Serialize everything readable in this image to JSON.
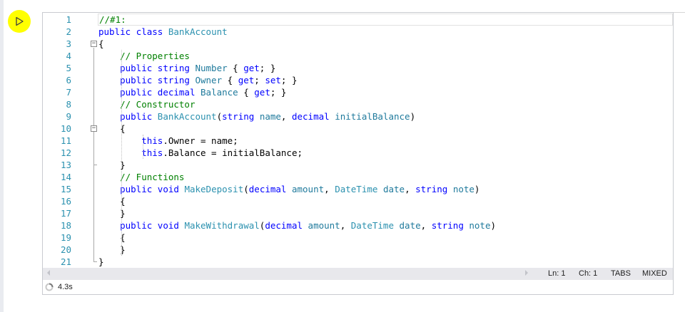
{
  "toolbar": {
    "run_icon": "run-triangle-icon",
    "highlight_color": "#ffff00"
  },
  "editor": {
    "lines": [
      {
        "n": "1",
        "tokens": [
          [
            "cmt",
            "//#1:"
          ]
        ]
      },
      {
        "n": "2",
        "tokens": [
          [
            "kw",
            "public"
          ],
          [
            "txt",
            " "
          ],
          [
            "kw",
            "class"
          ],
          [
            "txt",
            " "
          ],
          [
            "type",
            "BankAccount"
          ]
        ]
      },
      {
        "n": "3",
        "tokens": [
          [
            "txt",
            "{"
          ]
        ]
      },
      {
        "n": "4",
        "tokens": [
          [
            "txt",
            "    "
          ],
          [
            "cmt",
            "// Properties"
          ]
        ]
      },
      {
        "n": "5",
        "tokens": [
          [
            "txt",
            "    "
          ],
          [
            "kw",
            "public"
          ],
          [
            "txt",
            " "
          ],
          [
            "kw",
            "string"
          ],
          [
            "txt",
            " "
          ],
          [
            "param",
            "Number"
          ],
          [
            "txt",
            " { "
          ],
          [
            "kw",
            "get"
          ],
          [
            "txt",
            "; }"
          ]
        ]
      },
      {
        "n": "6",
        "tokens": [
          [
            "txt",
            "    "
          ],
          [
            "kw",
            "public"
          ],
          [
            "txt",
            " "
          ],
          [
            "kw",
            "string"
          ],
          [
            "txt",
            " "
          ],
          [
            "param",
            "Owner"
          ],
          [
            "txt",
            " { "
          ],
          [
            "kw",
            "get"
          ],
          [
            "txt",
            "; "
          ],
          [
            "kw",
            "set"
          ],
          [
            "txt",
            "; }"
          ]
        ]
      },
      {
        "n": "7",
        "tokens": [
          [
            "txt",
            "    "
          ],
          [
            "kw",
            "public"
          ],
          [
            "txt",
            " "
          ],
          [
            "kw",
            "decimal"
          ],
          [
            "txt",
            " "
          ],
          [
            "param",
            "Balance"
          ],
          [
            "txt",
            " { "
          ],
          [
            "kw",
            "get"
          ],
          [
            "txt",
            "; }"
          ]
        ]
      },
      {
        "n": "8",
        "tokens": [
          [
            "txt",
            "    "
          ],
          [
            "cmt",
            "// Constructor"
          ]
        ]
      },
      {
        "n": "9",
        "tokens": [
          [
            "txt",
            "    "
          ],
          [
            "kw",
            "public"
          ],
          [
            "txt",
            " "
          ],
          [
            "type",
            "BankAccount"
          ],
          [
            "txt",
            "("
          ],
          [
            "kw",
            "string"
          ],
          [
            "txt",
            " "
          ],
          [
            "param",
            "name"
          ],
          [
            "txt",
            ", "
          ],
          [
            "kw",
            "decimal"
          ],
          [
            "txt",
            " "
          ],
          [
            "param",
            "initialBalance"
          ],
          [
            "txt",
            ")"
          ]
        ]
      },
      {
        "n": "10",
        "tokens": [
          [
            "txt",
            "    {"
          ]
        ]
      },
      {
        "n": "11",
        "tokens": [
          [
            "txt",
            "        "
          ],
          [
            "kw",
            "this"
          ],
          [
            "txt",
            ".Owner = name;"
          ]
        ]
      },
      {
        "n": "12",
        "tokens": [
          [
            "txt",
            "        "
          ],
          [
            "kw",
            "this"
          ],
          [
            "txt",
            ".Balance = initialBalance;"
          ]
        ]
      },
      {
        "n": "13",
        "tokens": [
          [
            "txt",
            "    }"
          ]
        ]
      },
      {
        "n": "14",
        "tokens": [
          [
            "txt",
            "    "
          ],
          [
            "cmt",
            "// Functions"
          ]
        ]
      },
      {
        "n": "15",
        "tokens": [
          [
            "txt",
            "    "
          ],
          [
            "kw",
            "public"
          ],
          [
            "txt",
            " "
          ],
          [
            "kw",
            "void"
          ],
          [
            "txt",
            " "
          ],
          [
            "type",
            "MakeDeposit"
          ],
          [
            "txt",
            "("
          ],
          [
            "kw",
            "decimal"
          ],
          [
            "txt",
            " "
          ],
          [
            "param",
            "amount"
          ],
          [
            "txt",
            ", "
          ],
          [
            "type",
            "DateTime"
          ],
          [
            "txt",
            " "
          ],
          [
            "param",
            "date"
          ],
          [
            "txt",
            ", "
          ],
          [
            "kw",
            "string"
          ],
          [
            "txt",
            " "
          ],
          [
            "param",
            "note"
          ],
          [
            "txt",
            ")"
          ]
        ]
      },
      {
        "n": "16",
        "tokens": [
          [
            "txt",
            "    {"
          ]
        ]
      },
      {
        "n": "17",
        "tokens": [
          [
            "txt",
            "    }"
          ]
        ]
      },
      {
        "n": "18",
        "tokens": [
          [
            "txt",
            "    "
          ],
          [
            "kw",
            "public"
          ],
          [
            "txt",
            " "
          ],
          [
            "kw",
            "void"
          ],
          [
            "txt",
            " "
          ],
          [
            "type",
            "MakeWithdrawal"
          ],
          [
            "txt",
            "("
          ],
          [
            "kw",
            "decimal"
          ],
          [
            "txt",
            " "
          ],
          [
            "param",
            "amount"
          ],
          [
            "txt",
            ", "
          ],
          [
            "type",
            "DateTime"
          ],
          [
            "txt",
            " "
          ],
          [
            "param",
            "date"
          ],
          [
            "txt",
            ", "
          ],
          [
            "kw",
            "string"
          ],
          [
            "txt",
            " "
          ],
          [
            "param",
            "note"
          ],
          [
            "txt",
            ")"
          ]
        ]
      },
      {
        "n": "19",
        "tokens": [
          [
            "txt",
            "    {"
          ]
        ]
      },
      {
        "n": "20",
        "tokens": [
          [
            "txt",
            "    }"
          ]
        ]
      },
      {
        "n": "21",
        "tokens": [
          [
            "txt",
            "}"
          ]
        ]
      }
    ],
    "colors": {
      "keyword": "#0000ff",
      "type": "#2b91af",
      "comment": "#008000",
      "line_number": "#2b91af"
    }
  },
  "status": {
    "line": "Ln: 1",
    "column": "Ch: 1",
    "indent": "TABS",
    "line_endings": "MIXED"
  },
  "footer": {
    "exec_time": "4.3s",
    "spinner_icon": "spinner-icon"
  }
}
